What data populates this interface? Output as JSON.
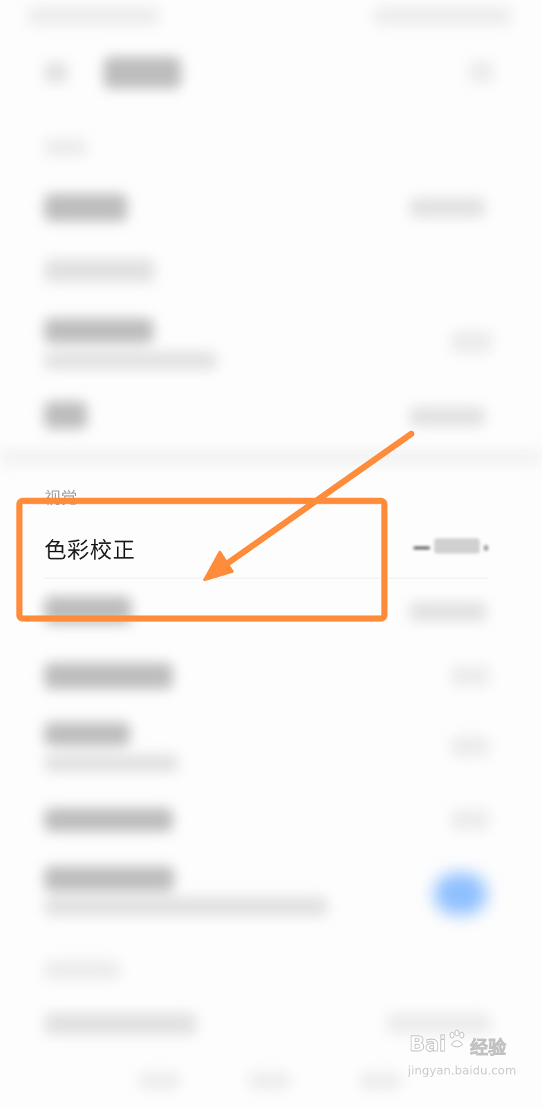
{
  "settings": {
    "section_title": "视觉",
    "highlighted_item": {
      "label": "色彩校正"
    }
  },
  "annotation": {
    "stroke_color": "#ff8c3a"
  },
  "watermark": {
    "brand": "Bai",
    "brand_suffix": "经验",
    "url": "jingyan.baidu.com"
  }
}
